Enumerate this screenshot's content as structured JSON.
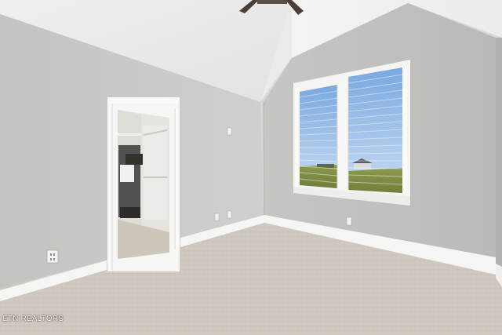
{
  "photo": {
    "subject": "vacant-bedroom-with-vaulted-ceiling",
    "watermark": "ETN REALTORS",
    "colors": {
      "wall_left": "#c9c8c4",
      "wall_right": "#c3c1bd",
      "ceiling": "#f1f1ef",
      "carpet": "#cbc4b9",
      "trim": "#f7f7f5",
      "window_sky": "#8fb7e6",
      "window_grass": "#7c8d42"
    }
  }
}
